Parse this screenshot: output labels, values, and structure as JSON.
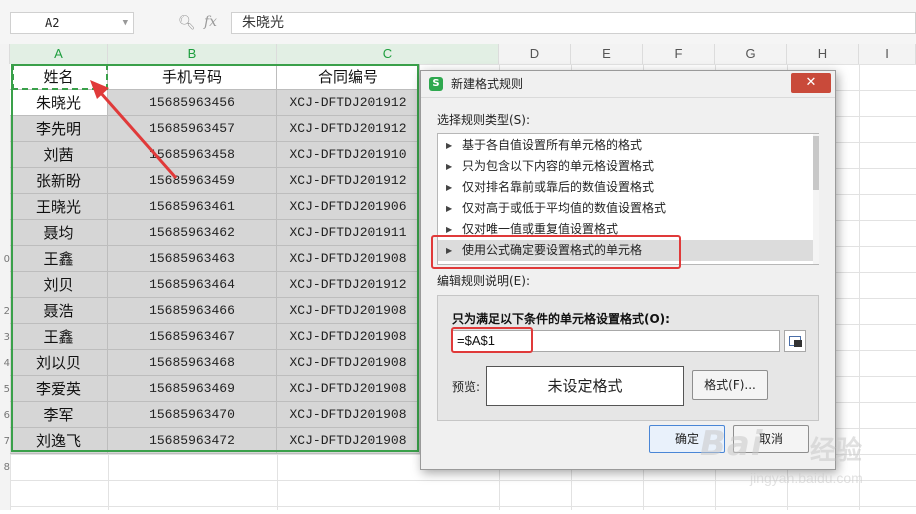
{
  "formula_bar": {
    "name_box": "A2",
    "formula": "朱晓光"
  },
  "columns": [
    "A",
    "B",
    "C",
    "D",
    "E",
    "F",
    "G",
    "H",
    "I"
  ],
  "headers": {
    "name": "姓名",
    "phone": "手机号码",
    "contract": "合同编号"
  },
  "rows": [
    {
      "name": "朱晓光",
      "phone": "15685963456",
      "contract": "XCJ-DFTDJ201912"
    },
    {
      "name": "李先明",
      "phone": "15685963457",
      "contract": "XCJ-DFTDJ201912"
    },
    {
      "name": "刘茜",
      "phone": "15685963458",
      "contract": "XCJ-DFTDJ201910"
    },
    {
      "name": "张新盼",
      "phone": "15685963459",
      "contract": "XCJ-DFTDJ201912"
    },
    {
      "name": "王晓光",
      "phone": "15685963461",
      "contract": "XCJ-DFTDJ201906"
    },
    {
      "name": "聂均",
      "phone": "15685963462",
      "contract": "XCJ-DFTDJ201911"
    },
    {
      "name": "王鑫",
      "phone": "15685963463",
      "contract": "XCJ-DFTDJ201908"
    },
    {
      "name": "刘贝",
      "phone": "15685963464",
      "contract": "XCJ-DFTDJ201912"
    },
    {
      "name": "聂浩",
      "phone": "15685963466",
      "contract": "XCJ-DFTDJ201908"
    },
    {
      "name": "王鑫",
      "phone": "15685963467",
      "contract": "XCJ-DFTDJ201908"
    },
    {
      "name": "刘以贝",
      "phone": "15685963468",
      "contract": "XCJ-DFTDJ201908"
    },
    {
      "name": "李爱英",
      "phone": "15685963469",
      "contract": "XCJ-DFTDJ201908"
    },
    {
      "name": "李军",
      "phone": "15685963470",
      "contract": "XCJ-DFTDJ201908"
    },
    {
      "name": "刘逸飞",
      "phone": "15685963472",
      "contract": "XCJ-DFTDJ201908"
    }
  ],
  "row_numbers": [
    "",
    "",
    "",
    "",
    "",
    "",
    "",
    "0",
    "",
    "2",
    "3",
    "4",
    "5",
    "6",
    "7",
    "8"
  ],
  "dialog": {
    "title": "新建格式规则",
    "app_icon": "S",
    "close_label": "✕",
    "rule_type_label": "选择规则类型(S):",
    "rule_types": [
      "基于各自值设置所有单元格的格式",
      "只为包含以下内容的单元格设置格式",
      "仅对排名靠前或靠后的数值设置格式",
      "仅对高于或低于平均值的数值设置格式",
      "仅对唯一值或重复值设置格式",
      "使用公式确定要设置格式的单元格"
    ],
    "selected_rule_index": 5,
    "description_label": "编辑规则说明(E):",
    "condition_label": "只为满足以下条件的单元格设置格式(O):",
    "condition_value": "=$A$1",
    "preview_label": "预览:",
    "preview_text": "未设定格式",
    "format_button": "格式(F)...",
    "ok_button": "确定",
    "cancel_button": "取消"
  },
  "annotation_color": "#e03a3a",
  "selection_color": "#3aa04a",
  "watermark": {
    "brand": "Bai",
    "brand_cn": "经验",
    "url": "jingyan.baidu.com"
  }
}
